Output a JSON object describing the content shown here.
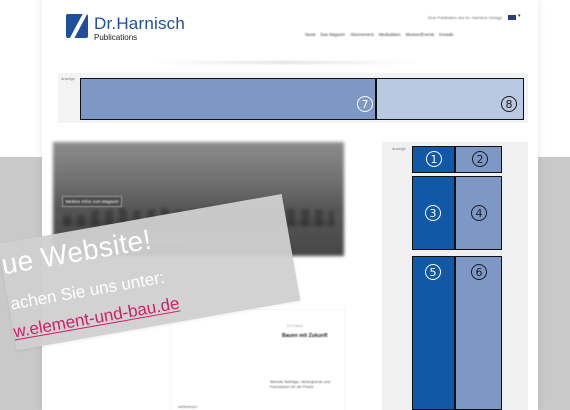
{
  "header": {
    "logo_title": "Dr.Harnisch",
    "logo_subtitle": "Publications",
    "topbar_note": "Eine Publikation des Dr. Harnisch Verlags",
    "nav": [
      "News",
      "Das Magazin",
      "Abonnement",
      "Mediadaten",
      "Messen/Events",
      "Kontakt"
    ]
  },
  "ads": {
    "top_label": "Anzeige",
    "side_label": "Anzeige",
    "slots": [
      {
        "num": "1",
        "color": "#1158a6",
        "text_color": "#ffffff"
      },
      {
        "num": "2",
        "color": "#7d98c5",
        "text_color": "#1a1a1a"
      },
      {
        "num": "3",
        "color": "#1158a6",
        "text_color": "#ffffff"
      },
      {
        "num": "4",
        "color": "#7d98c5",
        "text_color": "#1a1a1a"
      },
      {
        "num": "5",
        "color": "#1158a6",
        "text_color": "#ffffff"
      },
      {
        "num": "6",
        "color": "#7d98c5",
        "text_color": "#1a1a1a"
      },
      {
        "num": "7",
        "color": "#7d98c5",
        "text_color": "#ffffff"
      },
      {
        "num": "8",
        "color": "#b9c9e2",
        "text_color": "#1a1a1a"
      }
    ]
  },
  "hero": {
    "button_label": "Weitere Infos zum Magazin",
    "caption": "Gebäudehülle, Bauphysik und energieeffizientes Bauen im Fokus"
  },
  "post": {
    "meta": "Im Fokus",
    "heading": "Bauen mit Zukunft",
    "excerpt": "Aktuelle Beiträge, Hintergründe und Fachwissen für die Praxis.",
    "read_more": "weiterlesen"
  },
  "notice": {
    "title": "ue Website!",
    "subtitle": "achen Sie uns unter:",
    "link": "w.element-und-bau.de"
  },
  "colors": {
    "brand_blue": "#1f4e9a",
    "slot_dark": "#1158a6",
    "slot_mid": "#7d98c5",
    "slot_light": "#b9c9e2",
    "notice_link": "#d11d67"
  }
}
